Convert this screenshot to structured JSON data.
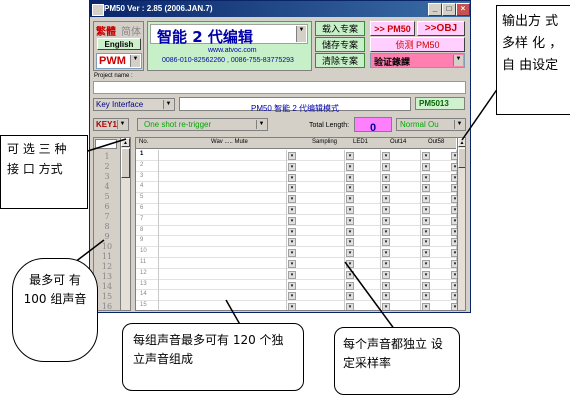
{
  "window": {
    "title": "PM50 Ver : 2.85 (2006.JAN.7)",
    "min": "_",
    "max": "□",
    "close": "×"
  },
  "lang": {
    "trad": "繁體",
    "simp": "简体",
    "english": "English"
  },
  "mode_select": "PWM",
  "banner": {
    "title": "智能 2 代编辑",
    "url": "www.atvoc.com",
    "phone": "0086-010-82562260 , 0086-755-83775293"
  },
  "project_buttons": {
    "load": "载入专案",
    "save": "儲存专案",
    "clear": "清除专案"
  },
  "right_buttons": {
    "pm50": ">> PM50",
    "obj": ">>OBJ",
    "detect": "侦测 PM50",
    "verify": "验证錄課"
  },
  "project_name_label": "Project name :",
  "interface": {
    "select": "Key Interface",
    "mode_text": "PM50 智能 2 代编辑模式",
    "chip": "PM5013"
  },
  "key_row": {
    "key": "KEY1",
    "trigger": "One shot re-trigger",
    "total_length_label": "Total Length:",
    "total_length_value": "0",
    "output_mode": "Normal Ou"
  },
  "table": {
    "headers": {
      "no": "No.",
      "wav": "Wav ..... Mute",
      "sampling": "Sampling",
      "led": "LED1",
      "out14": "Out14",
      "out58": "Out58"
    },
    "rows": [
      "1",
      "2",
      "3",
      "4",
      "5",
      "6",
      "7",
      "8",
      "9",
      "10",
      "11",
      "12",
      "13",
      "14",
      "15"
    ]
  },
  "key_list": [
    "1",
    "2",
    "3",
    "4",
    "5",
    "6",
    "7",
    "8",
    "9",
    "10",
    "11",
    "12",
    "13",
    "14",
    "15",
    "16"
  ],
  "callouts": {
    "interface": "可 选 三 种 接 口 方式",
    "groups": "最多可 有 100 组声音",
    "sounds": "每组声音最多可有 120 个独立声音组成",
    "sampling": "每个声音都独立 设定采样率",
    "output": "输出方 式 多样 化 ， 自 由设定"
  },
  "colors": {
    "titlebar": "#0a246a",
    "banner_green": "#c8f0c8",
    "banner_text": "#0000aa",
    "pwm_red": "#cc0000",
    "total_length_bg": "#ff80ff",
    "key_red": "#aa0000",
    "trigger_green": "#00aa00"
  }
}
